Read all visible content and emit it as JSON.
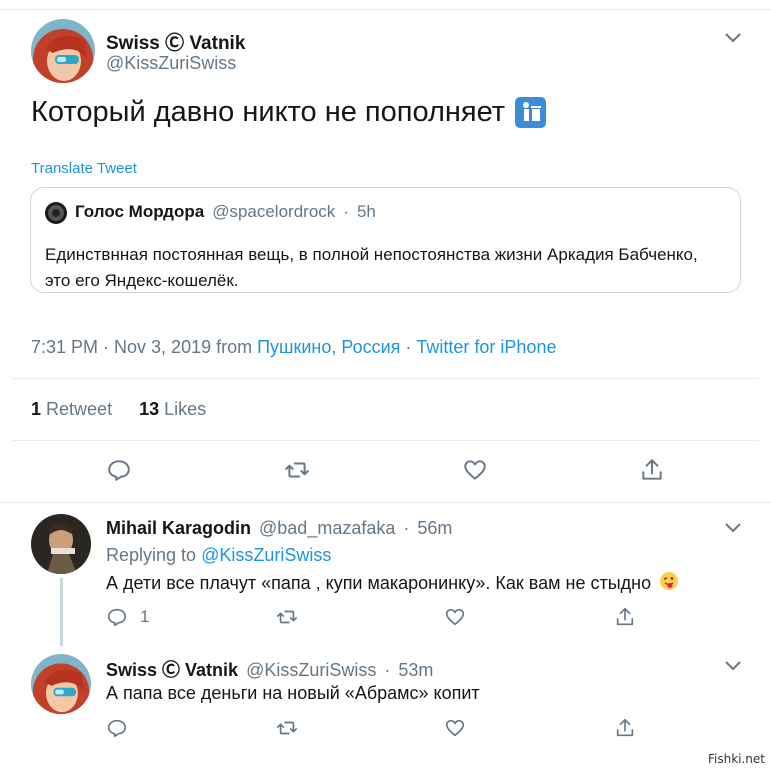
{
  "main_tweet": {
    "name": "Swiss Ⓒ Vatnik",
    "handle": "@KissZuriSwiss",
    "text": "Который давно никто не пополняет",
    "emoji": "🚮",
    "translate": "Translate Tweet",
    "quoted": {
      "name": "Голос Мордора",
      "handle": "@spacelordrock",
      "sep": "·",
      "time": "5h",
      "text": "Единствнная постоянная вещь, в полной непостоянства жизни Аркадия Бабченко, это его Яндекс-кошелёк."
    },
    "meta": {
      "time": "7:31 PM · Nov 3, 2019 from ",
      "location": "Пушкино, Россия",
      "sep": " · ",
      "source": "Twitter for iPhone"
    },
    "stats": {
      "retweets_count": "1",
      "retweets_label": "Retweet",
      "likes_count": "13",
      "likes_label": "Likes"
    }
  },
  "replies": [
    {
      "name": "Mihail Karagodin",
      "handle": "@bad_mazafaka",
      "sep": "·",
      "time": "56m",
      "replying_prefix": "Replying to ",
      "replying_to": "@KissZuriSwiss",
      "text": "А дети все плачут «папа , купи макаронинку». Как вам не стыдно",
      "emoji": "😜",
      "reply_count": "1"
    },
    {
      "name": "Swiss Ⓒ Vatnik",
      "handle": "@KissZuriSwiss",
      "sep": "·",
      "time": "53m",
      "text": "А папа все деньги на новый «Абрамс» копит"
    }
  ],
  "watermark": "Fishki.net",
  "colors": {
    "accent": "#1b95e0",
    "muted": "#657786",
    "border": "#e6ecf0"
  },
  "icons": [
    "chevron-down-icon",
    "reply-icon",
    "retweet-icon",
    "like-icon",
    "share-icon"
  ]
}
